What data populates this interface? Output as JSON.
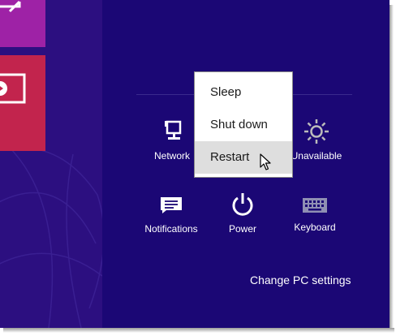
{
  "settings_pane": {
    "quick_settings": [
      {
        "label": "Network",
        "icon": "network-icon"
      },
      {
        "label": "Unavailable",
        "icon": "brightness-icon"
      },
      {
        "label": "Notifications",
        "icon": "notifications-icon"
      },
      {
        "label": "Power",
        "icon": "power-icon"
      },
      {
        "label": "Keyboard",
        "icon": "keyboard-icon"
      }
    ],
    "change_pc_settings": "Change PC settings"
  },
  "power_menu": {
    "items": [
      {
        "label": "Sleep"
      },
      {
        "label": "Shut down"
      },
      {
        "label": "Restart",
        "hovered": true
      }
    ]
  },
  "colors": {
    "pane_background": "#1b0775",
    "start_background": "#2c0f80",
    "tile_magenta": "#9e22a6",
    "tile_crimson": "#c2244d",
    "menu_hover": "#dedede"
  }
}
